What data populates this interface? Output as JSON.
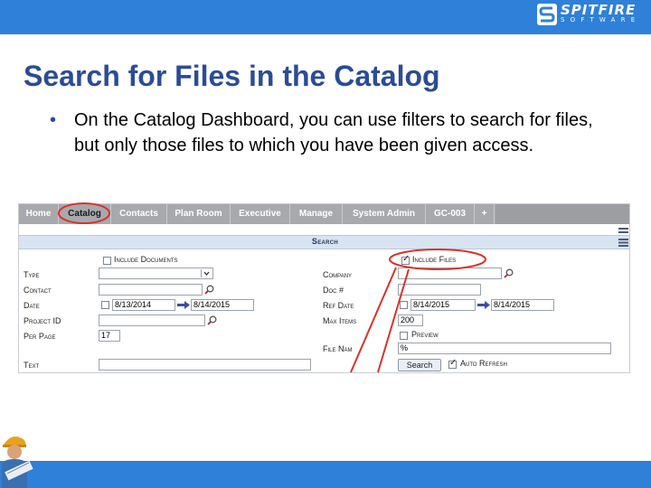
{
  "slide": {
    "title": "Search for Files in the Catalog",
    "bullet": "On the Catalog Dashboard, you can use filters to search for files, but only those files to which you have been given access."
  },
  "logo": {
    "name": "SPITFIRE",
    "subtitle": "SOFTWARE",
    "mark": "S"
  },
  "colors": {
    "accent": "#2f80d8",
    "title": "#2b4c96",
    "callout": "#d9322b"
  },
  "nav": {
    "tabs": [
      "Home",
      "Catalog",
      "Contacts",
      "Plan Room",
      "Executive",
      "Manage",
      "System Admin",
      "GC-003",
      "+"
    ],
    "active": "Catalog"
  },
  "search": {
    "header": "Search",
    "include_documents": "Include Documents",
    "include_files": "Include Files",
    "labels": {
      "type": "Type",
      "contact": "Contact",
      "date": "Date",
      "project_id": "Project ID",
      "per_page": "Per Page",
      "text": "Text",
      "company": "Company",
      "doc_no": "Doc #",
      "ref_date": "Ref Date",
      "max_items": "Max Items",
      "preview": "Preview",
      "file_name": "File Nam"
    },
    "values": {
      "date_from": "8/13/2014",
      "date_to": "8/14/2015",
      "ref_date_from": "8/14/2015",
      "ref_date_to": "8/14/2015",
      "max_items": "200",
      "per_page": "17",
      "file_name": "%"
    },
    "search_button": "Search",
    "auto_refresh": "Auto Refresh"
  }
}
